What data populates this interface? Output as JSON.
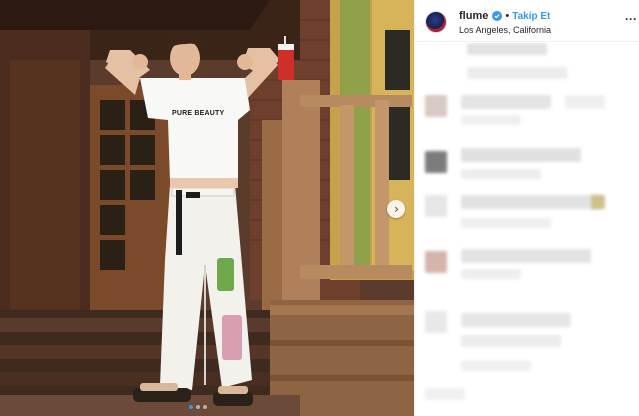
{
  "post": {
    "username": "flume",
    "separator": "•",
    "follow_label": "Takip Et",
    "location": "Los Angeles, California",
    "more_label": "···"
  },
  "media": {
    "shirt_text": "PURE BEAUTY",
    "carousel_count": 3,
    "carousel_active": 1
  },
  "icons": {
    "verified": "verified-badge-icon",
    "next": "chevron-right-icon",
    "more": "more-options-icon"
  },
  "colors": {
    "link_blue": "#3897f0",
    "verified_blue": "#3897f0",
    "text": "#262626",
    "divider": "#efefef"
  }
}
